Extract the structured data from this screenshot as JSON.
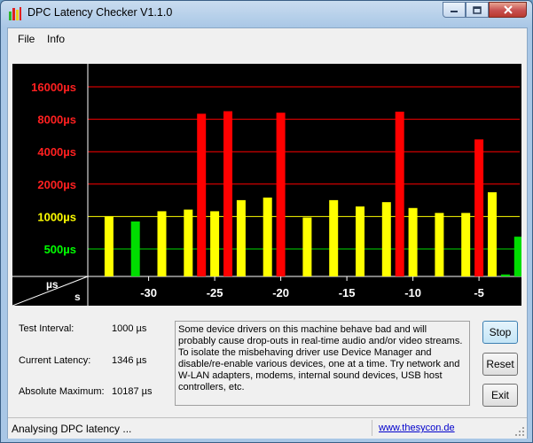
{
  "window": {
    "title": "DPC Latency Checker V1.1.0",
    "caption_buttons": [
      "minimize-icon",
      "maximize-icon",
      "close-icon"
    ]
  },
  "menu": {
    "items": [
      "File",
      "Info"
    ]
  },
  "chart_data": {
    "type": "bar",
    "y_tick_labels": [
      "16000µs",
      "8000µs",
      "4000µs",
      "2000µs",
      "1000µs",
      "500µs"
    ],
    "y_tick_values": [
      16000,
      8000,
      4000,
      2000,
      1000,
      500
    ],
    "y_scale": "log",
    "x_tick_labels": [
      "-30",
      "-25",
      "-20",
      "-15",
      "-10",
      "-5"
    ],
    "x_tick_values": [
      -30,
      -25,
      -20,
      -15,
      -10,
      -5
    ],
    "corner_label_top": "µs",
    "corner_label_bottom": "s",
    "x": [
      -34,
      -33,
      -32,
      -31,
      -30,
      -29,
      -28,
      -27,
      -26,
      -25,
      -24,
      -23,
      -22,
      -21,
      -20,
      -19,
      -18,
      -17,
      -16,
      -15,
      -14,
      -13,
      -12,
      -11,
      -10,
      -9,
      -8,
      -7,
      -6,
      -5,
      -4,
      -3,
      -2,
      -1
    ],
    "values": [
      250,
      1000,
      240,
      900,
      180,
      1120,
      240,
      1160,
      9000,
      1120,
      9500,
      1420,
      240,
      1500,
      9200,
      240,
      980,
      250,
      1420,
      260,
      1240,
      250,
      1360,
      9400,
      1200,
      240,
      1080,
      230,
      1080,
      5200,
      1680,
      290,
      650,
      400
    ],
    "colors": [
      "#00dd00",
      "#ffff00",
      "#00dd00",
      "#00dd00",
      "#00dd00",
      "#ffff00",
      "#00dd00",
      "#ffff00",
      "#ff0000",
      "#ffff00",
      "#ff0000",
      "#ffff00",
      "#00dd00",
      "#ffff00",
      "#ff0000",
      "#00dd00",
      "#ffff00",
      "#00dd00",
      "#ffff00",
      "#00dd00",
      "#ffff00",
      "#00dd00",
      "#ffff00",
      "#ff0000",
      "#ffff00",
      "#00dd00",
      "#ffff00",
      "#00dd00",
      "#ffff00",
      "#ff0000",
      "#ffff00",
      "#00dd00",
      "#00dd00",
      "#00dd00"
    ],
    "threshold_colors": {
      "high": "#ff0000",
      "medium": "#ffff00",
      "low": "#00dd00"
    },
    "label_colors": {
      "red": "#ff2020",
      "yellow": "#ffff00",
      "green": "#00ff00",
      "axis": "#ffffff"
    }
  },
  "info": {
    "test_interval_label": "Test Interval:",
    "test_interval_value": "1000 µs",
    "current_latency_label": "Current Latency:",
    "current_latency_value": "1346 µs",
    "absolute_maximum_label": "Absolute Maximum:",
    "absolute_maximum_value": "10187 µs"
  },
  "description": "Some device drivers on this machine behave bad and will probably cause drop-outs in real-time audio and/or video streams. To isolate the misbehaving driver use Device Manager and disable/re-enable various devices, one at a time. Try network and W-LAN adapters, modems, internal sound devices, USB host controllers, etc.",
  "buttons": {
    "stop": "Stop",
    "reset": "Reset",
    "exit": "Exit"
  },
  "status": {
    "text": "Analysing DPC latency ...",
    "link": "www.thesycon.de"
  }
}
